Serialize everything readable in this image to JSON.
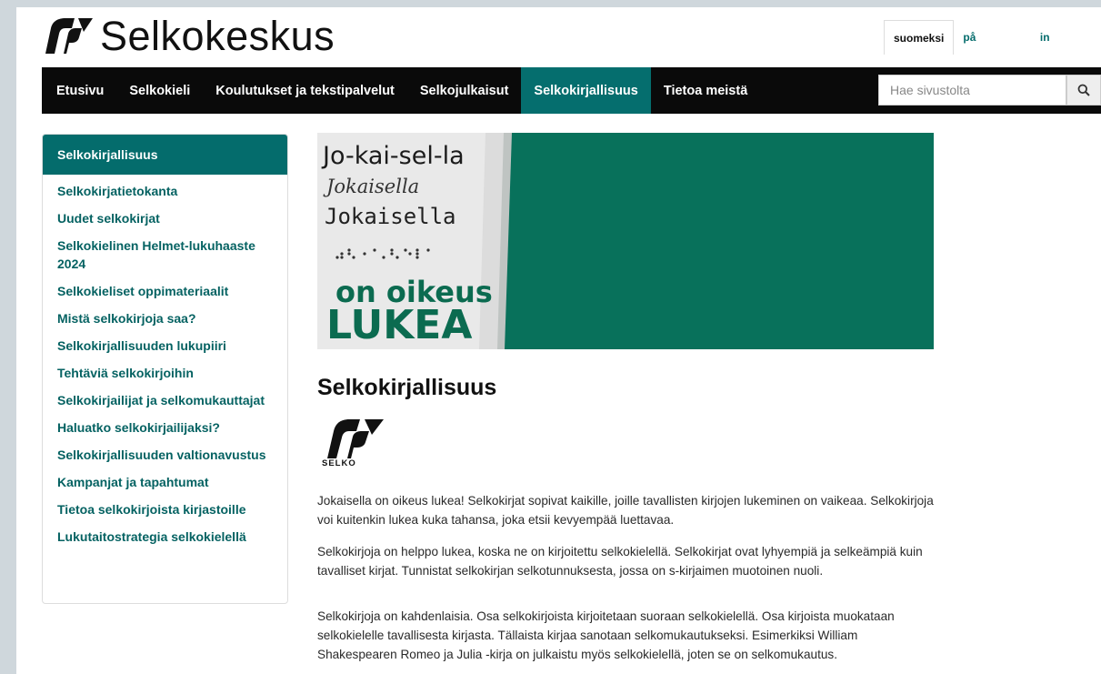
{
  "header": {
    "site_title": "Selkokeskus",
    "languages": [
      "suomeksi",
      "på svenska",
      "in English"
    ]
  },
  "nav": {
    "items": [
      "Etusivu",
      "Selkokieli",
      "Koulutukset ja tekstipalvelut",
      "Selkojulkaisut",
      "Selkokirjallisuus",
      "Tietoa meistä"
    ],
    "active": "Selkokirjallisuus",
    "search_placeholder": "Hae sivustolta"
  },
  "sidebar": {
    "title": "Selkokirjallisuus",
    "items": [
      "Selkokirjatietokanta",
      "Uudet selkokirjat",
      "Selkokielinen Helmet-lukuhaaste 2024",
      "Selkokieliset oppimateriaalit",
      "Mistä selkokirjoja saa?",
      "Selkokirjallisuuden lukupiiri",
      "Tehtäviä selkokirjoihin",
      "Selkokirjailijat ja selkomukauttajat",
      "Haluatko selkokirjailijaksi?",
      "Selkokirjallisuuden valtionavustus",
      "Kampanjat ja tapahtumat",
      "Tietoa selkokirjoista kirjastoille",
      "Lukutaitostrategia selkokielellä"
    ]
  },
  "banner": {
    "line1": "Jo-kai-sel-la",
    "line2": "Jokaisella",
    "line3": "Jokaisella",
    "line4": "on oikeus",
    "line5": "LUKEA"
  },
  "content": {
    "title": "Selkokirjallisuus",
    "logo_label": "SELKO",
    "paragraphs": [
      "Jokaisella on oikeus lukea! Selkokirjat sopivat kaikille, joille tavallisten kirjojen lukeminen on vaikeaa. Selkokirjoja voi kuitenkin lukea kuka tahansa, joka etsii kevyempää luettavaa.",
      "Selkokirjoja on helppo lukea, koska ne on kirjoitettu selkokielellä. Selkokirjat ovat lyhyempiä ja selkeämpiä kuin tavalliset kirjat. Tunnistat selkokirjan selkotunnuksesta, jossa on s-kirjaimen muotoinen nuoli.",
      "Selkokirjoja on kahdenlaisia. Osa selkokirjoista kirjoitetaan suoraan selkokielellä. Osa kirjoista muokataan selkokielelle tavallisesta kirjasta. Tällaista kirjaa sanotaan selkomukautukseksi. Esimerkiksi William Shakespearen Romeo ja Julia -kirja on julkaistu myös selkokielellä, joten se on selkomukautus."
    ]
  },
  "colors": {
    "accent": "#046c6c",
    "nav_bg": "#0a0a0a",
    "banner_green": "#08715b"
  }
}
